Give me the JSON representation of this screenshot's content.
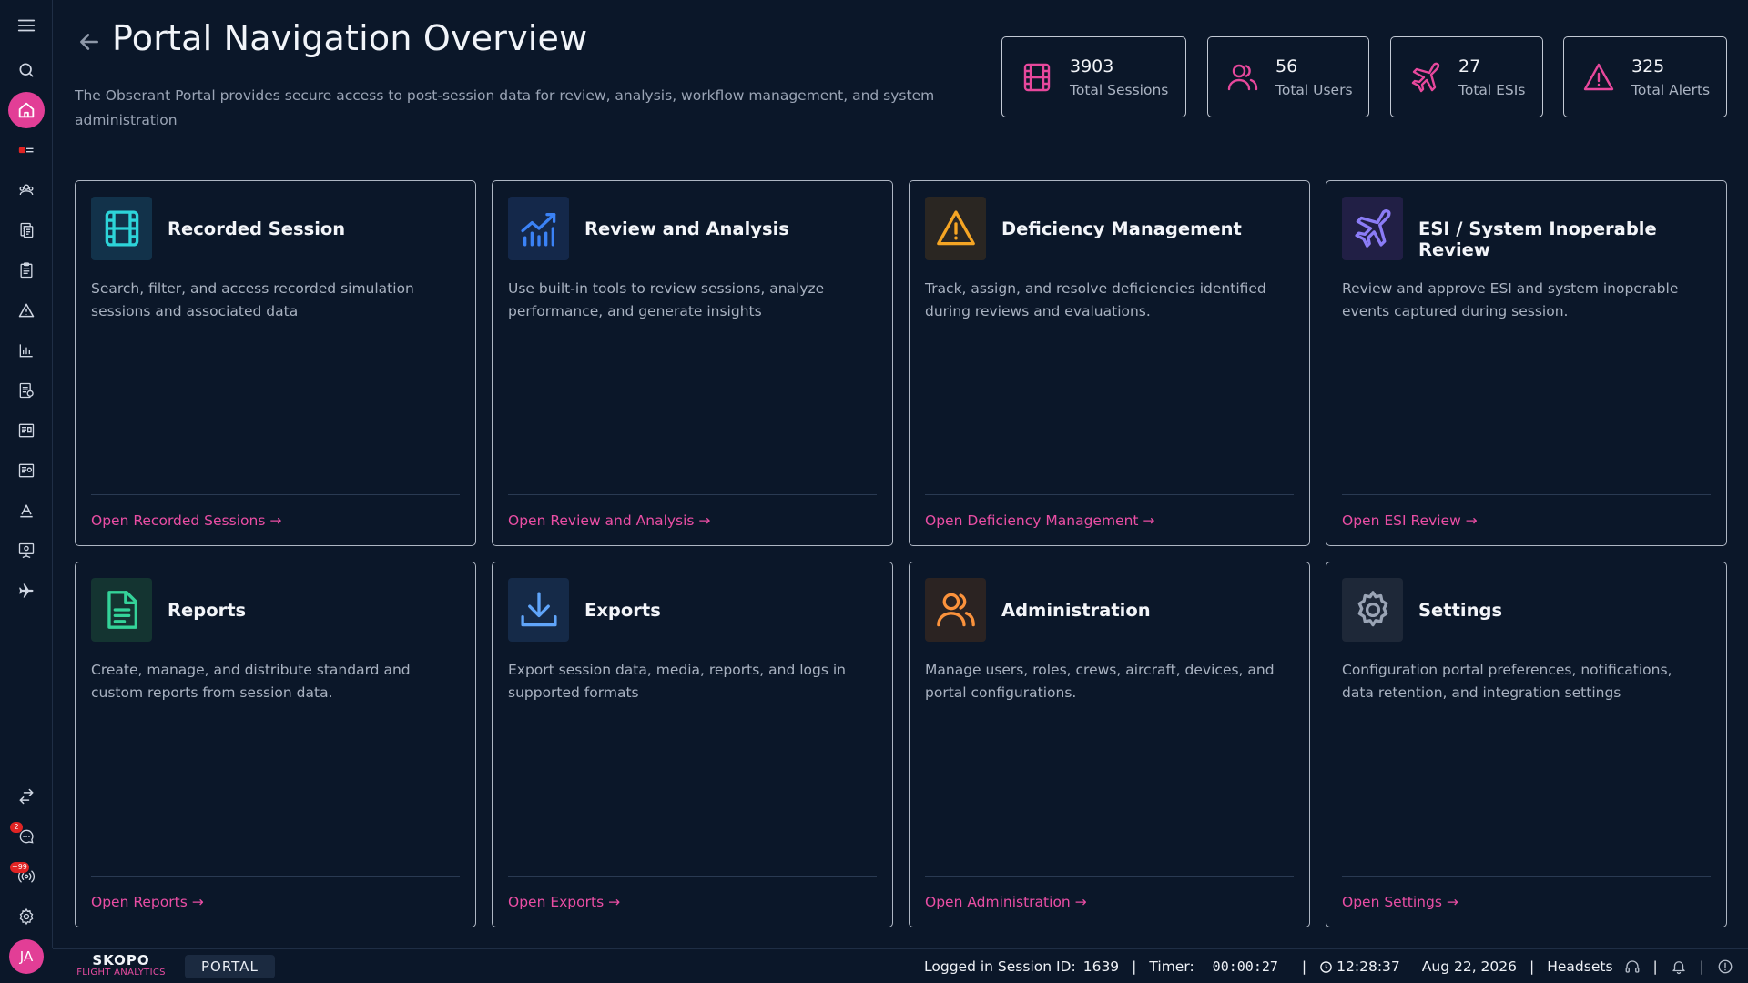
{
  "page": {
    "title": "Portal Navigation Overview",
    "description": "The Obserant Portal provides secure access to post-session data for review, analysis, workflow management, and system administration"
  },
  "stats": [
    {
      "value": "3903",
      "label": "Total Sessions",
      "icon": "film-icon"
    },
    {
      "value": "56",
      "label": "Total Users",
      "icon": "users-icon"
    },
    {
      "value": "27",
      "label": "Total ESIs",
      "icon": "plane-icon"
    },
    {
      "value": "325",
      "label": "Total Alerts",
      "icon": "alert-triangle-icon"
    }
  ],
  "cards": [
    {
      "title": "Recorded Session",
      "description": "Search, filter, and access recorded simulation sessions and associated data",
      "link": "Open Recorded Sessions →",
      "icon": "film-icon",
      "accent": "#2dd4d9"
    },
    {
      "title": "Review and Analysis",
      "description": "Use built-in tools to review sessions, analyze performance, and generate insights",
      "link": "Open Review and Analysis →",
      "icon": "chart-line-icon",
      "accent": "#3b82f6"
    },
    {
      "title": "Deficiency Management",
      "description": "Track, assign, and resolve deficiencies identified during reviews and evaluations.",
      "link": "Open Deficiency Management →",
      "icon": "alert-triangle-icon",
      "accent": "#f5a524"
    },
    {
      "title": "ESI / System Inoperable Review",
      "description": "Review and approve ESI and system inoperable events captured during session.",
      "link": "Open ESI Review →",
      "icon": "plane-icon",
      "accent": "#8b7cf6"
    },
    {
      "title": "Reports",
      "description": "Create, manage, and distribute standard and custom reports from session data.",
      "link": "Open Reports →",
      "icon": "document-icon",
      "accent": "#34d399"
    },
    {
      "title": "Exports",
      "description": "Export session data, media, reports, and logs in supported formats",
      "link": "Open Exports →",
      "icon": "download-icon",
      "accent": "#60a5fa"
    },
    {
      "title": "Administration",
      "description": "Manage users, roles, crews, aircraft, devices, and portal configurations.",
      "link": "Open Administration →",
      "icon": "users-icon",
      "accent": "#fb923c"
    },
    {
      "title": "Settings",
      "description": "Configuration portal preferences, notifications, data retention, and integration settings",
      "link": "Open Settings →",
      "icon": "gear-icon",
      "accent": "#9aa4b5"
    }
  ],
  "sidebar": {
    "chat_badge": "2",
    "radio_badge": "+99",
    "avatar": "JA"
  },
  "footer": {
    "brand": "SKOPO",
    "brand_sub": "FLIGHT ANALYTICS",
    "portal": "PORTAL",
    "session_label": "Logged in Session ID:",
    "session_id": "1639",
    "timer_label": "Timer:",
    "timer": "00:00:27",
    "clock": "12:28:37",
    "date": "Aug 22, 2026",
    "headsets": "Headsets"
  },
  "colors": {
    "background": "#0b1729",
    "accent_pink": "#e7489c",
    "border": "#aeb6c3"
  }
}
